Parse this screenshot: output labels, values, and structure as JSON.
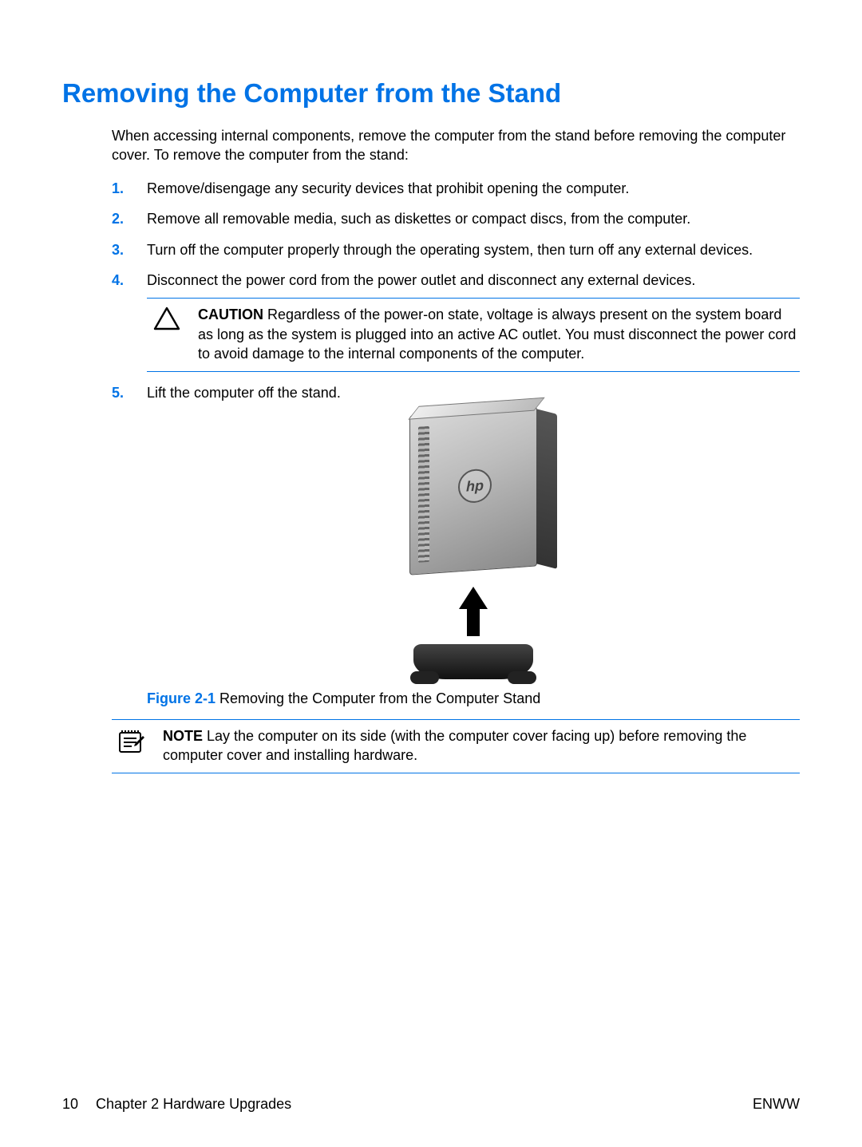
{
  "title": "Removing the Computer from the Stand",
  "intro": "When accessing internal components, remove the computer from the stand before removing the computer cover. To remove the computer from the stand:",
  "steps": [
    {
      "num": "1.",
      "text": "Remove/disengage any security devices that prohibit opening the computer."
    },
    {
      "num": "2.",
      "text": "Remove all removable media, such as diskettes or compact discs, from the computer."
    },
    {
      "num": "3.",
      "text": "Turn off the computer properly through the operating system, then turn off any external devices."
    },
    {
      "num": "4.",
      "text": "Disconnect the power cord from the power outlet and disconnect any external devices."
    },
    {
      "num": "5.",
      "text": "Lift the computer off the stand."
    }
  ],
  "caution": {
    "label": "CAUTION",
    "text": "   Regardless of the power-on state, voltage is always present on the system board as long as the system is plugged into an active AC outlet. You must disconnect the power cord to avoid damage to the internal components of the computer."
  },
  "figure": {
    "label": "Figure 2-1",
    "caption": "  Removing the Computer from the Computer Stand"
  },
  "note": {
    "label": "NOTE",
    "text": "   Lay the computer on its side (with the computer cover facing up) before removing the computer cover and installing hardware."
  },
  "footer": {
    "page": "10",
    "chapter": "Chapter 2   Hardware Upgrades",
    "right": "ENWW"
  }
}
